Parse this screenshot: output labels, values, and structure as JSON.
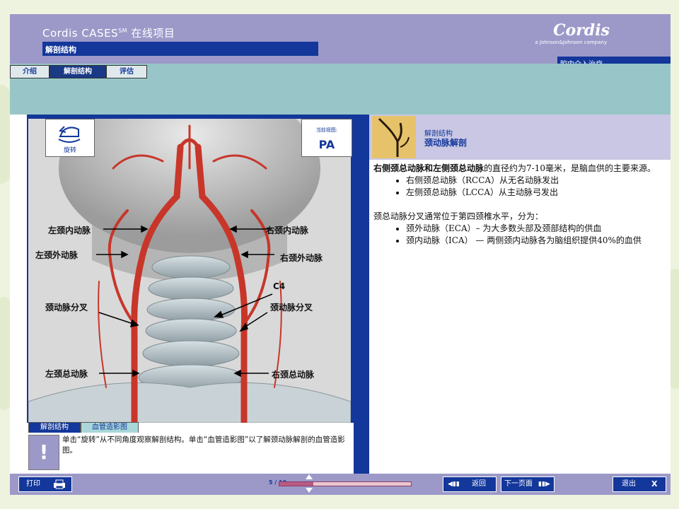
{
  "header": {
    "app_title": "Cordis CASES",
    "app_title_sup": "SM",
    "app_title_suffix": " 在线项目",
    "section": "解剖结构",
    "logo": "Cordis",
    "logo_sub": "a Johnson&Johnson company",
    "tagline": "腔内介入治疗"
  },
  "tabs": [
    {
      "label": "介绍",
      "active": false
    },
    {
      "label": "解剖结构",
      "active": true
    },
    {
      "label": "评估",
      "active": false
    }
  ],
  "image_panel": {
    "rotate_label": "旋转",
    "view_caption": "当前视图:",
    "view_value": "PA",
    "labels": {
      "l_ica": "左颈内动脉",
      "r_ica": "右颈内动脉",
      "l_eca": "左颈外动脉",
      "r_eca": "右颈外动脉",
      "c4": "C4",
      "l_bif": "颈动脉分叉",
      "r_bif": "颈动脉分叉",
      "l_cca": "左颈总动脉",
      "r_cca": "右颈总动脉"
    },
    "subtabs": [
      "解剖结构",
      "血管造影图"
    ],
    "note_icon": "!",
    "note": "单击“旋转”从不同角度观察解剖结构。单击“血管造影图”以了解颈动脉解剖的血管造影图。"
  },
  "right_panel": {
    "head_small": "解剖结构",
    "head_title": "颈动脉解剖",
    "p1_bold": "右侧颈总动脉和左侧颈总动脉",
    "p1_rest": "的直径约为7-10毫米，是脑血供的主要来源。",
    "list1": [
      "右侧颈总动脉（RCCA）从无名动脉发出",
      "左侧颈总动脉（LCCA）从主动脉弓发出"
    ],
    "p2": "颈总动脉分叉通常位于第四颈椎水平，分为：",
    "list2": [
      "颈外动脉（ECA）– 为大多数头部及颈部结构的供血",
      "颈内动脉（ICA） — 两侧颈内动脉各为脑组织提供40%的血供"
    ]
  },
  "bottom": {
    "print": "打印",
    "page": "5 / 19",
    "progress": 0.26,
    "back": "返回",
    "next": "下一页面",
    "exit": "退出",
    "exit_x": "X"
  },
  "colors": {
    "accent": "#13379a",
    "header": "#9c99c9",
    "tabstrip": "#98c6c8",
    "artery": "#c8362a"
  }
}
